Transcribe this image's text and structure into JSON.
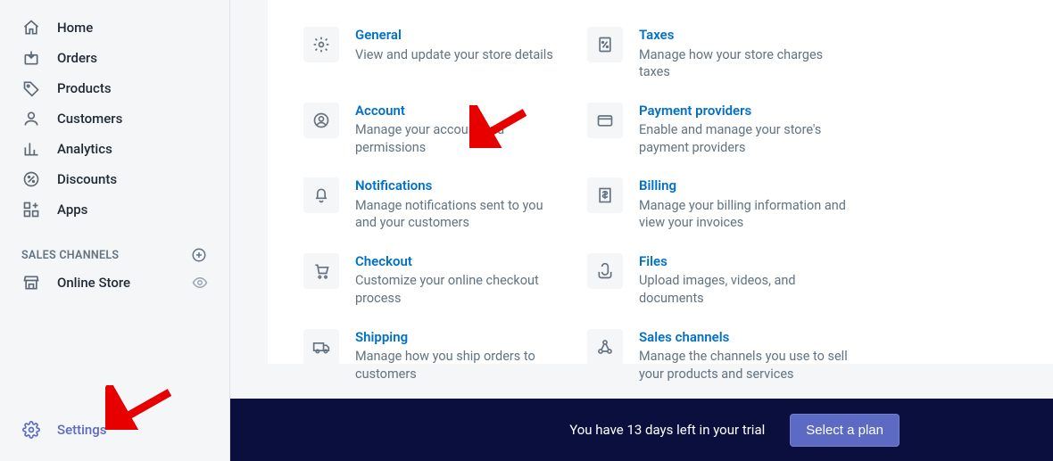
{
  "sidebar": {
    "items": [
      {
        "label": "Home"
      },
      {
        "label": "Orders"
      },
      {
        "label": "Products"
      },
      {
        "label": "Customers"
      },
      {
        "label": "Analytics"
      },
      {
        "label": "Discounts"
      },
      {
        "label": "Apps"
      }
    ],
    "channels_header": "SALES CHANNELS",
    "channels": [
      {
        "label": "Online Store"
      }
    ],
    "settings_label": "Settings"
  },
  "settings_tiles": [
    {
      "title": "General",
      "desc": "View and update your store details"
    },
    {
      "title": "Taxes",
      "desc": "Manage how your store charges taxes"
    },
    {
      "title": "Account",
      "desc": "Manage your account and permissions"
    },
    {
      "title": "Payment providers",
      "desc": "Enable and manage your store's payment providers"
    },
    {
      "title": "Notifications",
      "desc": "Manage notifications sent to you and your customers"
    },
    {
      "title": "Billing",
      "desc": "Manage your billing information and view your invoices"
    },
    {
      "title": "Checkout",
      "desc": "Customize your online checkout process"
    },
    {
      "title": "Files",
      "desc": "Upload images, videos, and documents"
    },
    {
      "title": "Shipping",
      "desc": "Manage how you ship orders to customers"
    },
    {
      "title": "Sales channels",
      "desc": "Manage the channels you use to sell your products and services"
    }
  ],
  "trial": {
    "message": "You have 13 days left in your trial",
    "button": "Select a plan"
  }
}
